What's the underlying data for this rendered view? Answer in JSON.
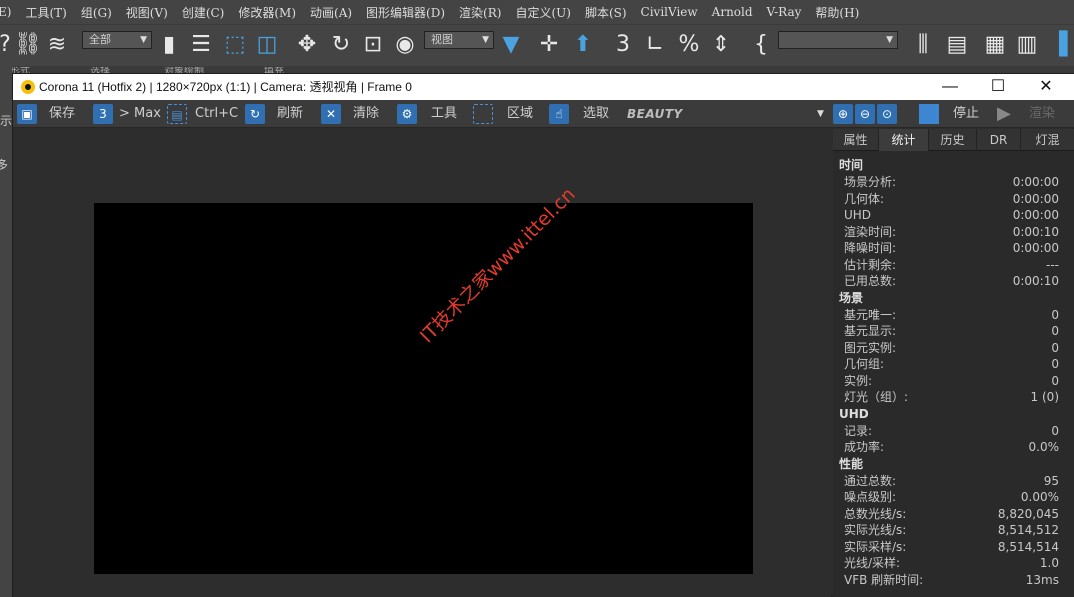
{
  "max_menu": [
    "E)",
    "工具(T)",
    "组(G)",
    "视图(V)",
    "创建(C)",
    "修改器(M)",
    "动画(A)",
    "图形编辑器(D)",
    "渲染(R)",
    "自定义(U)",
    "脚本(S)",
    "CivilView",
    "Arnold",
    "V-Ray",
    "帮助(H)"
  ],
  "max_toolbar": {
    "selection_filter": "全部",
    "ref_coord": "视图",
    "sublabels": [
      "由形式",
      "选择",
      "对象绘制",
      "填充"
    ],
    "left_strip_chars": [
      "示",
      "多"
    ]
  },
  "vfb": {
    "title": "Corona 11 (Hotfix 2) | 1280×720px (1:1) | Camera: 透视视角 | Frame 0",
    "toolbar": {
      "save": "保存",
      "max": "> Max",
      "copy": "Ctrl+C",
      "refresh": "刷新",
      "clear": "清除",
      "tools": "工具",
      "region": "区域",
      "pick": "选取",
      "channel": "BEAUTY",
      "stop": "停止",
      "render": "渲染"
    },
    "watermark": "IT技术之家www.ittel.cn"
  },
  "panel": {
    "tabs": [
      "属性",
      "统计",
      "历史",
      "DR",
      "灯混"
    ],
    "active_tab": "统计",
    "sections": [
      {
        "title": "时间",
        "rows": [
          [
            "场景分析:",
            "0:00:00"
          ],
          [
            "几何体:",
            "0:00:00"
          ],
          [
            "UHD",
            "0:00:00"
          ],
          [
            "渲染时间:",
            "0:00:10"
          ],
          [
            "降噪时间:",
            "0:00:00"
          ],
          [
            "估计剩余:",
            "---"
          ],
          [
            "已用总数:",
            "0:00:10"
          ]
        ]
      },
      {
        "title": "场景",
        "rows": [
          [
            "基元唯一:",
            "0"
          ],
          [
            "基元显示:",
            "0"
          ],
          [
            "图元实例:",
            "0"
          ],
          [
            "几何组:",
            "0"
          ],
          [
            "实例:",
            "0"
          ],
          [
            "灯光（组）:",
            "1 (0)"
          ]
        ]
      },
      {
        "title": "UHD",
        "rows": [
          [
            "记录:",
            "0"
          ],
          [
            "成功率:",
            "0.0%"
          ]
        ]
      },
      {
        "title": "性能",
        "rows": [
          [
            "通过总数:",
            "95"
          ],
          [
            "噪点级别:",
            "0.00%"
          ],
          [
            "总数光线/s:",
            "8,820,045"
          ],
          [
            "实际光线/s:",
            "8,514,512"
          ],
          [
            "实际采样/s:",
            "8,514,514"
          ],
          [
            "光线/采样:",
            "1.0"
          ],
          [
            "VFB 刷新时间:",
            "13ms"
          ]
        ]
      }
    ]
  }
}
